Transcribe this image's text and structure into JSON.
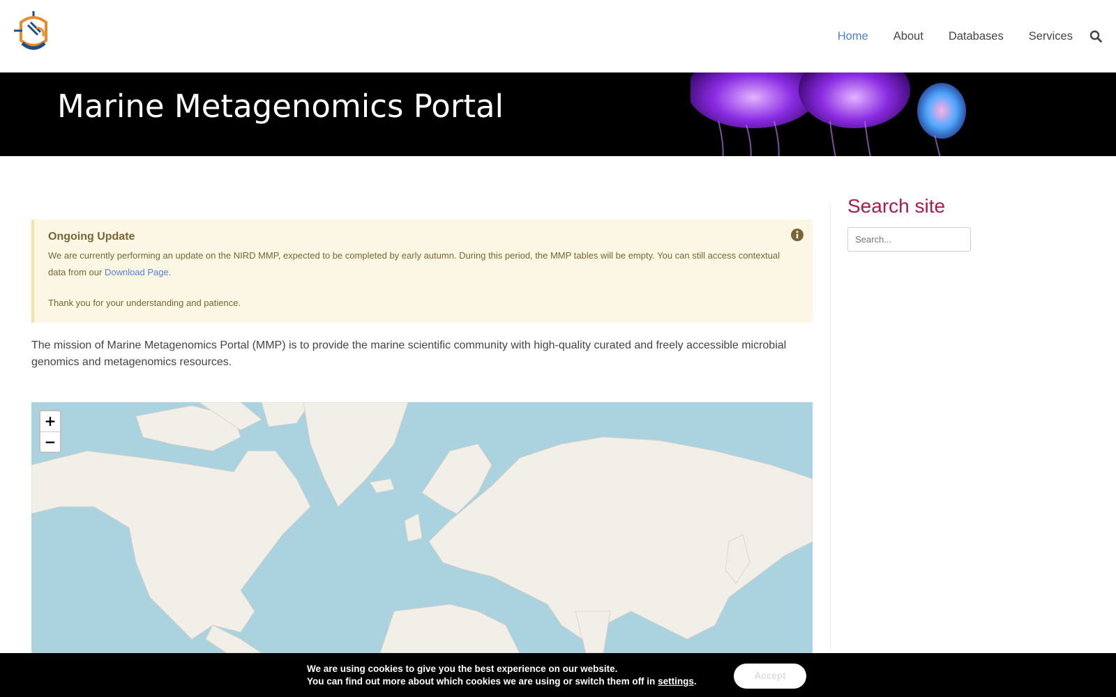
{
  "nav": {
    "items": [
      {
        "label": "Home",
        "active": true
      },
      {
        "label": "About"
      },
      {
        "label": "Databases"
      },
      {
        "label": "Services"
      }
    ]
  },
  "banner": {
    "title": "Marine Metagenomics Portal"
  },
  "notice": {
    "title": "Ongoing Update",
    "body_pre": "We are currently performing an update on the NIRD MMP, expected to be completed by early autumn. During this period, the MMP tables will be empty. You can still access contextual data from our",
    "link_label": "Download Page",
    "body_post": ".",
    "thanks": "Thank you for your understanding and patience."
  },
  "mission": "The mission of Marine Metagenomics Portal (MMP) is to provide the marine scientific community with high-quality curated and freely accessible microbial genomics and metagenomics resources.",
  "sidebar": {
    "title": "Search site",
    "search_placeholder": "Search..."
  },
  "map": {
    "zoom_in": "+",
    "zoom_out": "−"
  },
  "cookie": {
    "line1": "We are using cookies to give you the best experience on our website.",
    "line2_pre": "You can find out more about which cookies we are using or switch them off in",
    "settings_link": "settings",
    "line2_post": ".",
    "accept_label": "Accept"
  },
  "colors": {
    "accent": "#4f7fd8",
    "sidebar_title": "#a81b4b",
    "notice_bg": "#fcf7e4",
    "map_water": "#aad3df",
    "map_land": "#f2efe9"
  }
}
